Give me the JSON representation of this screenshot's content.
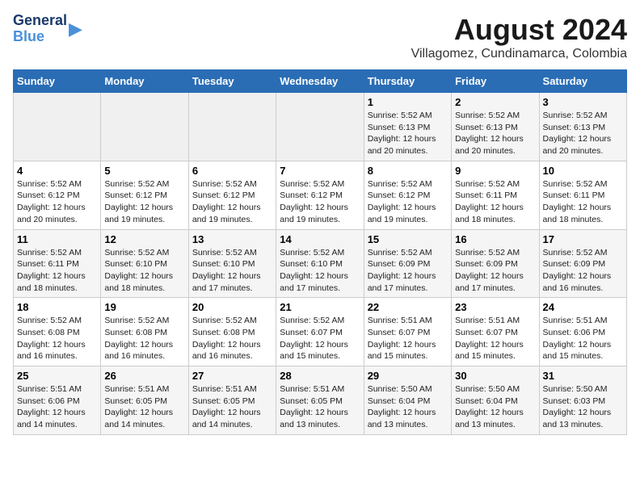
{
  "logo": {
    "line1": "General",
    "line2": "Blue"
  },
  "title": "August 2024",
  "subtitle": "Villagomez, Cundinamarca, Colombia",
  "weekdays": [
    "Sunday",
    "Monday",
    "Tuesday",
    "Wednesday",
    "Thursday",
    "Friday",
    "Saturday"
  ],
  "weeks": [
    [
      {
        "day": "",
        "text": ""
      },
      {
        "day": "",
        "text": ""
      },
      {
        "day": "",
        "text": ""
      },
      {
        "day": "",
        "text": ""
      },
      {
        "day": "1",
        "text": "Sunrise: 5:52 AM\nSunset: 6:13 PM\nDaylight: 12 hours\nand 20 minutes."
      },
      {
        "day": "2",
        "text": "Sunrise: 5:52 AM\nSunset: 6:13 PM\nDaylight: 12 hours\nand 20 minutes."
      },
      {
        "day": "3",
        "text": "Sunrise: 5:52 AM\nSunset: 6:13 PM\nDaylight: 12 hours\nand 20 minutes."
      }
    ],
    [
      {
        "day": "4",
        "text": "Sunrise: 5:52 AM\nSunset: 6:12 PM\nDaylight: 12 hours\nand 20 minutes."
      },
      {
        "day": "5",
        "text": "Sunrise: 5:52 AM\nSunset: 6:12 PM\nDaylight: 12 hours\nand 19 minutes."
      },
      {
        "day": "6",
        "text": "Sunrise: 5:52 AM\nSunset: 6:12 PM\nDaylight: 12 hours\nand 19 minutes."
      },
      {
        "day": "7",
        "text": "Sunrise: 5:52 AM\nSunset: 6:12 PM\nDaylight: 12 hours\nand 19 minutes."
      },
      {
        "day": "8",
        "text": "Sunrise: 5:52 AM\nSunset: 6:12 PM\nDaylight: 12 hours\nand 19 minutes."
      },
      {
        "day": "9",
        "text": "Sunrise: 5:52 AM\nSunset: 6:11 PM\nDaylight: 12 hours\nand 18 minutes."
      },
      {
        "day": "10",
        "text": "Sunrise: 5:52 AM\nSunset: 6:11 PM\nDaylight: 12 hours\nand 18 minutes."
      }
    ],
    [
      {
        "day": "11",
        "text": "Sunrise: 5:52 AM\nSunset: 6:11 PM\nDaylight: 12 hours\nand 18 minutes."
      },
      {
        "day": "12",
        "text": "Sunrise: 5:52 AM\nSunset: 6:10 PM\nDaylight: 12 hours\nand 18 minutes."
      },
      {
        "day": "13",
        "text": "Sunrise: 5:52 AM\nSunset: 6:10 PM\nDaylight: 12 hours\nand 17 minutes."
      },
      {
        "day": "14",
        "text": "Sunrise: 5:52 AM\nSunset: 6:10 PM\nDaylight: 12 hours\nand 17 minutes."
      },
      {
        "day": "15",
        "text": "Sunrise: 5:52 AM\nSunset: 6:09 PM\nDaylight: 12 hours\nand 17 minutes."
      },
      {
        "day": "16",
        "text": "Sunrise: 5:52 AM\nSunset: 6:09 PM\nDaylight: 12 hours\nand 17 minutes."
      },
      {
        "day": "17",
        "text": "Sunrise: 5:52 AM\nSunset: 6:09 PM\nDaylight: 12 hours\nand 16 minutes."
      }
    ],
    [
      {
        "day": "18",
        "text": "Sunrise: 5:52 AM\nSunset: 6:08 PM\nDaylight: 12 hours\nand 16 minutes."
      },
      {
        "day": "19",
        "text": "Sunrise: 5:52 AM\nSunset: 6:08 PM\nDaylight: 12 hours\nand 16 minutes."
      },
      {
        "day": "20",
        "text": "Sunrise: 5:52 AM\nSunset: 6:08 PM\nDaylight: 12 hours\nand 16 minutes."
      },
      {
        "day": "21",
        "text": "Sunrise: 5:52 AM\nSunset: 6:07 PM\nDaylight: 12 hours\nand 15 minutes."
      },
      {
        "day": "22",
        "text": "Sunrise: 5:51 AM\nSunset: 6:07 PM\nDaylight: 12 hours\nand 15 minutes."
      },
      {
        "day": "23",
        "text": "Sunrise: 5:51 AM\nSunset: 6:07 PM\nDaylight: 12 hours\nand 15 minutes."
      },
      {
        "day": "24",
        "text": "Sunrise: 5:51 AM\nSunset: 6:06 PM\nDaylight: 12 hours\nand 15 minutes."
      }
    ],
    [
      {
        "day": "25",
        "text": "Sunrise: 5:51 AM\nSunset: 6:06 PM\nDaylight: 12 hours\nand 14 minutes."
      },
      {
        "day": "26",
        "text": "Sunrise: 5:51 AM\nSunset: 6:05 PM\nDaylight: 12 hours\nand 14 minutes."
      },
      {
        "day": "27",
        "text": "Sunrise: 5:51 AM\nSunset: 6:05 PM\nDaylight: 12 hours\nand 14 minutes."
      },
      {
        "day": "28",
        "text": "Sunrise: 5:51 AM\nSunset: 6:05 PM\nDaylight: 12 hours\nand 13 minutes."
      },
      {
        "day": "29",
        "text": "Sunrise: 5:50 AM\nSunset: 6:04 PM\nDaylight: 12 hours\nand 13 minutes."
      },
      {
        "day": "30",
        "text": "Sunrise: 5:50 AM\nSunset: 6:04 PM\nDaylight: 12 hours\nand 13 minutes."
      },
      {
        "day": "31",
        "text": "Sunrise: 5:50 AM\nSunset: 6:03 PM\nDaylight: 12 hours\nand 13 minutes."
      }
    ]
  ]
}
